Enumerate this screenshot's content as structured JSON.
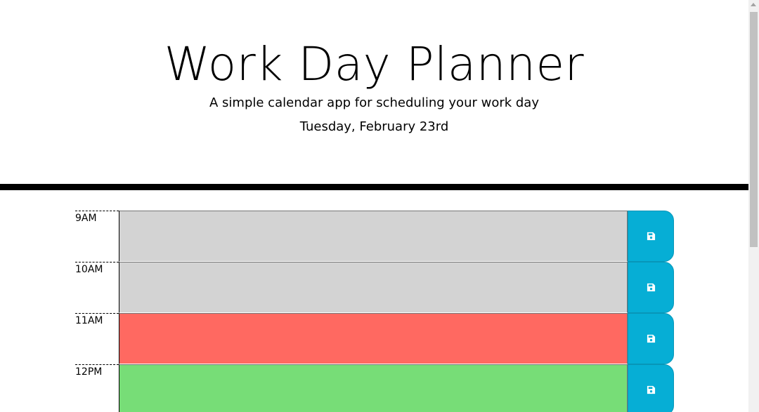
{
  "header": {
    "title": "Work Day Planner",
    "lead": "A simple calendar app for scheduling your work day",
    "current_day": "Tuesday, February 23rd"
  },
  "colors": {
    "past": "#d3d3d3",
    "present": "#ff6961",
    "future": "#77dd77",
    "save_button": "#06aed5"
  },
  "time_blocks": [
    {
      "hour": "9AM",
      "state": "past",
      "text": "",
      "icon": "save-icon"
    },
    {
      "hour": "10AM",
      "state": "past",
      "text": "",
      "icon": "save-icon"
    },
    {
      "hour": "11AM",
      "state": "present",
      "text": "",
      "icon": "save-icon"
    },
    {
      "hour": "12PM",
      "state": "future",
      "text": "",
      "icon": "save-icon"
    }
  ]
}
